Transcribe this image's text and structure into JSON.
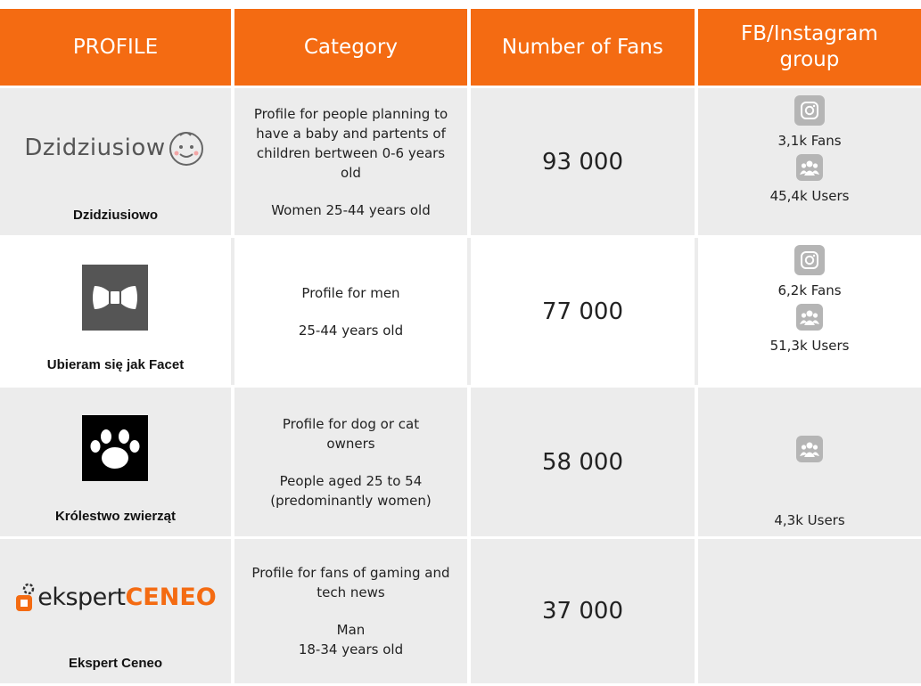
{
  "header": {
    "profile": "PROFILE",
    "category": "Category",
    "fans": "Number of Fans",
    "group": "FB/Instagram group"
  },
  "colors": {
    "accent": "#f46b12",
    "row_bg": "#ececec",
    "icon_bg": "#b5b5b5"
  },
  "rows": [
    {
      "name": "Dzidziusiowo",
      "logo_text": "Dzidziusiow",
      "category_lines": [
        "Profile for people planning to have a baby and partents of children bertween 0-6 years old"
      ],
      "category_note": "Women 25-44 years old",
      "fans": "93 000",
      "instagram": "3,1k Fans",
      "group_users": "45,4k Users"
    },
    {
      "name": "Ubieram się jak Facet",
      "category_lines": [
        "Profile for men"
      ],
      "category_note": "25-44 years old",
      "fans": "77 000",
      "instagram": "6,2k Fans",
      "group_users": "51,3k Users"
    },
    {
      "name": "Królestwo zwierząt",
      "category_lines": [
        "Profile for dog or cat owners"
      ],
      "category_note": "People aged 25 to 54 (predominantly women)",
      "fans": "58 000",
      "group_users": "4,3k Users"
    },
    {
      "name": "Ekspert Ceneo",
      "logo_text_a": "ekspert",
      "logo_text_b": "CENEO",
      "category_lines": [
        "Profile for fans of gaming and tech news"
      ],
      "category_note_a": "Man",
      "category_note_b": "18-34 years old",
      "fans": "37 000"
    }
  ]
}
